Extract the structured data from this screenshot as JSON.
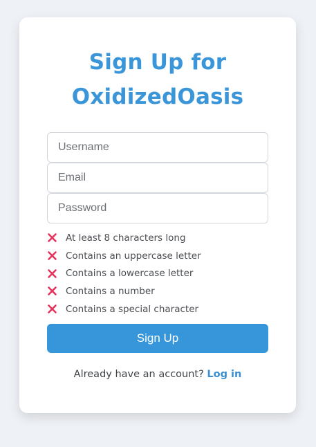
{
  "page": {
    "title_line1": "Sign Up for",
    "title_line2": "OxidizedOasis"
  },
  "form": {
    "username_placeholder": "Username",
    "email_placeholder": "Email",
    "password_placeholder": "Password",
    "submit_label": "Sign Up"
  },
  "requirements": [
    {
      "label": "At least 8 characters long",
      "met": false,
      "icon": "x-icon"
    },
    {
      "label": "Contains an uppercase letter",
      "met": false,
      "icon": "x-icon"
    },
    {
      "label": "Contains a lowercase letter",
      "met": false,
      "icon": "x-icon"
    },
    {
      "label": "Contains a number",
      "met": false,
      "icon": "x-icon"
    },
    {
      "label": "Contains a special character",
      "met": false,
      "icon": "x-icon"
    }
  ],
  "footer": {
    "text": "Already have an account?",
    "link_label": "Log in"
  },
  "colors": {
    "accent": "#3796d9",
    "unmet_icon": "#e8325c",
    "background": "#eef1f5"
  }
}
